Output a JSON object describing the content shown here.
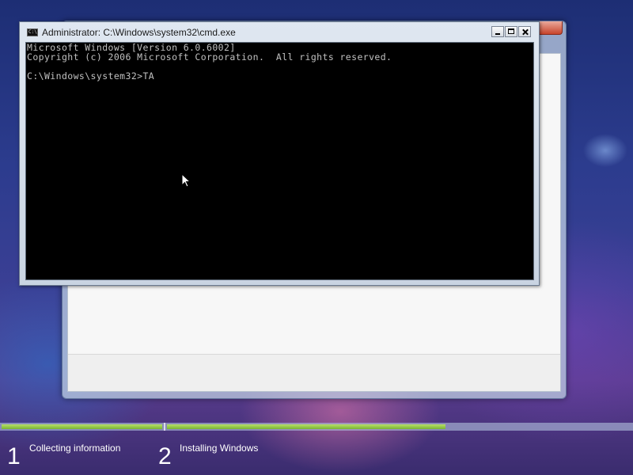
{
  "cmd_window": {
    "title": "Administrator: C:\\Windows\\system32\\cmd.exe",
    "icon_text": "C:\\",
    "console_lines": [
      "Microsoft Windows [Version 6.0.6002]",
      "Copyright (c) 2006 Microsoft Corporation.  All rights reserved.",
      "",
      "C:\\Windows\\system32>TA"
    ]
  },
  "setup_progress": {
    "steps": [
      {
        "number": "1",
        "label": "Collecting information",
        "progress_fraction": 1.0
      },
      {
        "number": "2",
        "label": "Installing Windows",
        "progress_fraction": 0.6
      }
    ]
  },
  "colors": {
    "console_bg": "#000000",
    "console_text": "#c0c0c0",
    "progress_green": "#8cc63f"
  },
  "icons": [
    "cmd-icon",
    "minimize-icon",
    "maximize-icon",
    "close-icon",
    "mouse-pointer-icon"
  ]
}
